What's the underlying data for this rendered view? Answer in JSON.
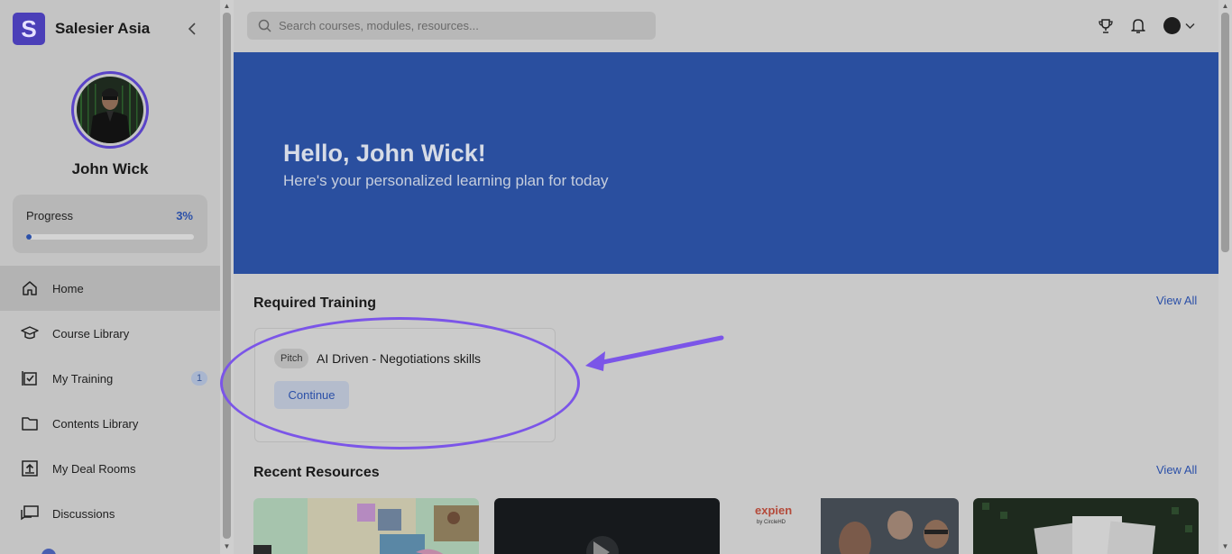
{
  "brand": {
    "logo_letter": "S",
    "name": "Salesier Asia"
  },
  "user": {
    "name": "John Wick"
  },
  "progress": {
    "label": "Progress",
    "value_text": "3%",
    "fraction": 0.03
  },
  "nav": {
    "items": [
      {
        "label": "Home",
        "icon": "home-icon",
        "active": true
      },
      {
        "label": "Course Library",
        "icon": "graduation-cap-icon"
      },
      {
        "label": "My Training",
        "icon": "checklist-icon",
        "badge": "1"
      },
      {
        "label": "Contents Library",
        "icon": "folder-icon"
      },
      {
        "label": "My Deal Rooms",
        "icon": "upload-box-icon"
      },
      {
        "label": "Discussions",
        "icon": "chat-icon"
      }
    ]
  },
  "search": {
    "placeholder": "Search courses, modules, resources..."
  },
  "hero": {
    "title": "Hello, John Wick!",
    "subtitle": "Here's your personalized learning plan for today"
  },
  "required_training": {
    "title": "Required Training",
    "view_all": "View All",
    "cards": [
      {
        "tag": "Pitch",
        "title": "AI Driven - Negotiations skills",
        "button": "Continue"
      }
    ]
  },
  "recent_resources": {
    "title": "Recent Resources",
    "view_all": "View All",
    "thumbs": [
      {
        "kind": "collage"
      },
      {
        "kind": "video"
      },
      {
        "kind": "expien",
        "brand": "expien",
        "sub": "by CircleHD"
      },
      {
        "kind": "documents"
      }
    ]
  },
  "colors": {
    "accent": "#2b50a8",
    "brand": "#4b3fb8",
    "hero_bg": "#2a4f9f",
    "annotation": "#7b55e8"
  }
}
